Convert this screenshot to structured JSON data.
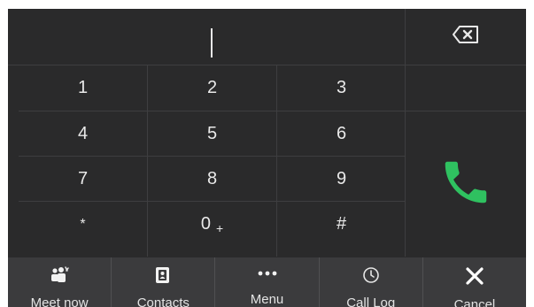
{
  "display": {
    "entered_number": ""
  },
  "keypad": [
    {
      "main": "1",
      "sub": ""
    },
    {
      "main": "2",
      "sub": ""
    },
    {
      "main": "3",
      "sub": ""
    },
    {
      "main": "4",
      "sub": ""
    },
    {
      "main": "5",
      "sub": ""
    },
    {
      "main": "6",
      "sub": ""
    },
    {
      "main": "7",
      "sub": ""
    },
    {
      "main": "8",
      "sub": ""
    },
    {
      "main": "9",
      "sub": ""
    },
    {
      "main": "*",
      "sub": ""
    },
    {
      "main": "0",
      "sub": "+"
    },
    {
      "main": "#",
      "sub": ""
    }
  ],
  "icons": {
    "backspace": "backspace-icon",
    "call": "phone-call-icon",
    "meet_now": "meet-now-icon",
    "contacts": "contacts-icon",
    "menu": "more-dots-icon",
    "call_log": "clock-icon",
    "cancel": "close-icon"
  },
  "colors": {
    "background": "#2a2a2b",
    "toolbar": "#3b3b3d",
    "call_green": "#2fc160",
    "text": "#e9e9e9"
  },
  "toolbar": {
    "meet_now": "Meet now",
    "contacts": "Contacts",
    "menu": "Menu",
    "call_log": "Call Log",
    "cancel": "Cancel"
  }
}
